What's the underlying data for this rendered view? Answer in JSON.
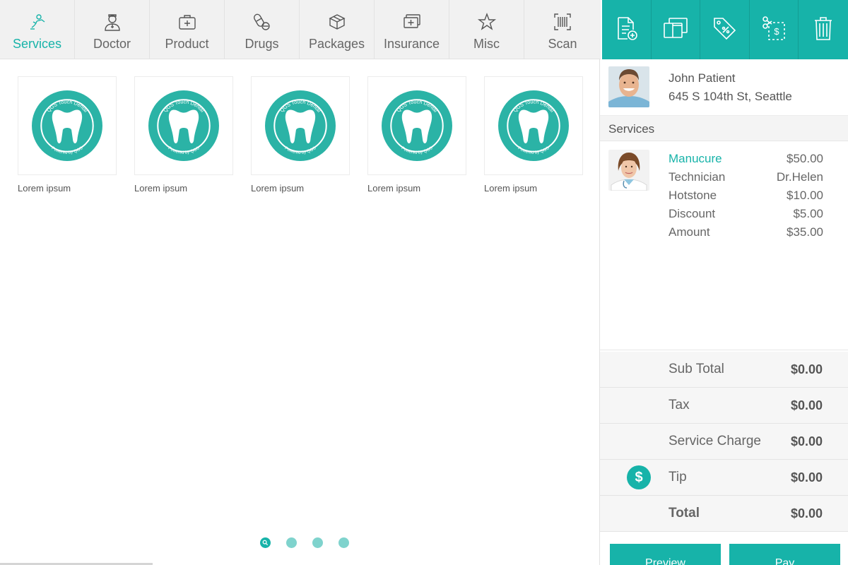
{
  "nav": {
    "tabs": [
      {
        "label": "Services",
        "icon": "dental-services-icon"
      },
      {
        "label": "Doctor",
        "icon": "doctor-icon"
      },
      {
        "label": "Product",
        "icon": "first-aid-kit-icon"
      },
      {
        "label": "Drugs",
        "icon": "pill-capsule-icon"
      },
      {
        "label": "Packages",
        "icon": "package-box-icon"
      },
      {
        "label": "Insurance",
        "icon": "insurance-card-icon"
      },
      {
        "label": "Misc",
        "icon": "star-icon"
      },
      {
        "label": "Scan",
        "icon": "barcode-scan-icon"
      }
    ],
    "active": "Services"
  },
  "actions": [
    "add-document-icon",
    "copy-ticket-icon",
    "discount-tag-icon",
    "split-coupon-icon",
    "trash-icon"
  ],
  "products": [
    {
      "caption": "Lorem ipsum"
    },
    {
      "caption": "Lorem ipsum"
    },
    {
      "caption": "Lorem ipsum"
    },
    {
      "caption": "Lorem ipsum"
    },
    {
      "caption": "Lorem ipsum"
    }
  ],
  "logo": {
    "top_text": "QGS Touch Dental",
    "bottom_text": "Powered by QGS"
  },
  "pager": {
    "pages": 4,
    "current": 1
  },
  "patient": {
    "name": "John Patient",
    "address": "645 S 104th St, Seattle"
  },
  "services_header": "Services",
  "service": {
    "lines": [
      {
        "label": "Manucure",
        "value": "$50.00"
      },
      {
        "label": "Technician",
        "value": "Dr.Helen"
      },
      {
        "label": "Hotstone",
        "value": "$10.00"
      },
      {
        "label": "Discount",
        "value": "$5.00"
      },
      {
        "label": "Amount",
        "value": "$35.00"
      }
    ]
  },
  "totals": {
    "sub_total": {
      "label": "Sub Total",
      "value": "$0.00"
    },
    "tax": {
      "label": "Tax",
      "value": "$0.00"
    },
    "service_charge": {
      "label": "Service Charge",
      "value": "$0.00"
    },
    "tip": {
      "label": "Tip",
      "value": "$0.00",
      "icon_text": "$"
    },
    "total": {
      "label": "Total",
      "value": "$0.00"
    }
  },
  "buttons": {
    "preview": "Preview",
    "pay": "Pay"
  },
  "colors": {
    "accent": "#17b3a9",
    "accent_light": "#7fd3cd",
    "nav_bg": "#f1f1f1"
  }
}
